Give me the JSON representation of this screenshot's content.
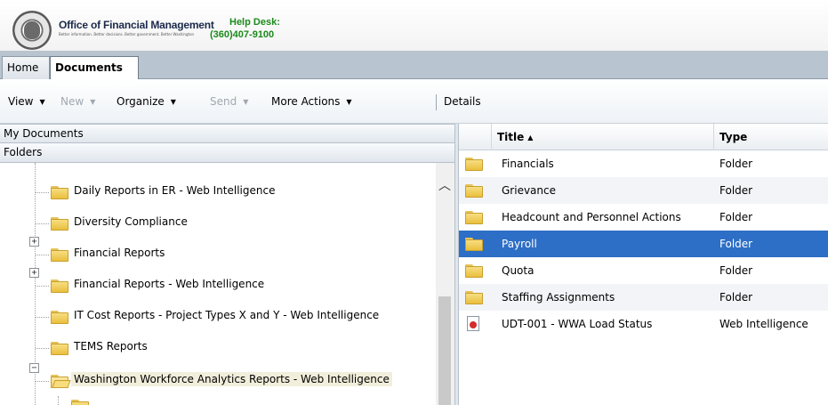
{
  "header": {
    "org_name": "Office of Financial Management",
    "tagline": "Better information. Better decisions. Better government. Better Washington",
    "help_label": "Help Desk:",
    "help_phone": "(360)407-9100",
    "logo_icon": "state-seal-icon"
  },
  "tabs": [
    {
      "label": "Home"
    },
    {
      "label": "Documents",
      "active": true
    }
  ],
  "toolbar": {
    "view": "View",
    "new": "New",
    "organize": "Organize",
    "send": "Send",
    "more_actions": "More Actions",
    "details": "Details",
    "dropdown_glyph": "▼"
  },
  "left_panel": {
    "my_documents": "My Documents",
    "folders": "Folders",
    "tree": [
      {
        "label": "Daily Reports in ER - Web Intelligence",
        "expandable": false
      },
      {
        "label": "Diversity Compliance",
        "expandable": false
      },
      {
        "label": "Financial Reports",
        "expandable": true
      },
      {
        "label": "Financial Reports - Web Intelligence",
        "expandable": true
      },
      {
        "label": "IT Cost Reports - Project Types X and Y - Web Intelligence",
        "expandable": false
      },
      {
        "label": "TEMS Reports",
        "expandable": false
      },
      {
        "label": "Washington Workforce Analytics Reports - Web Intelligence",
        "expandable": true,
        "expanded": true,
        "selected": true
      }
    ]
  },
  "grid": {
    "columns": {
      "title": "Title",
      "type": "Type"
    },
    "sort_glyph": "▲",
    "rows": [
      {
        "title": "Financials",
        "type": "Folder",
        "icon": "folder-icon"
      },
      {
        "title": "Grievance",
        "type": "Folder",
        "icon": "folder-icon"
      },
      {
        "title": "Headcount and Personnel Actions",
        "type": "Folder",
        "icon": "folder-icon"
      },
      {
        "title": "Payroll",
        "type": "Folder",
        "icon": "folder-icon",
        "selected": true
      },
      {
        "title": "Quota",
        "type": "Folder",
        "icon": "folder-icon"
      },
      {
        "title": "Staffing Assignments",
        "type": "Folder",
        "icon": "folder-icon"
      },
      {
        "title": "UDT-001 - WWA Load Status",
        "type": "Web Intelligence",
        "icon": "web-intelligence-icon"
      }
    ]
  },
  "colors": {
    "selection": "#2d6ec6",
    "tabbar": "#b8c4cf",
    "help_text": "#1b8a1b",
    "tree_selection": "#f1eedb"
  }
}
